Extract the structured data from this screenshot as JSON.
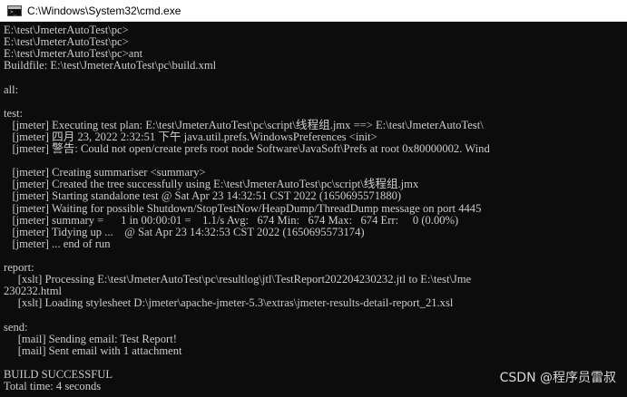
{
  "window": {
    "title": "C:\\Windows\\System32\\cmd.exe",
    "icon": "cmd-window-icon",
    "icon_glyph": ">_"
  },
  "console": {
    "text_color": "#cccccc",
    "background": "#0c0c0c",
    "lines": [
      "E:\\test\\JmeterAutoTest\\pc>",
      "E:\\test\\JmeterAutoTest\\pc>",
      "E:\\test\\JmeterAutoTest\\pc>ant",
      "Buildfile: E:\\test\\JmeterAutoTest\\pc\\build.xml",
      "",
      "all:",
      "",
      "test:",
      "   [jmeter] Executing test plan: E:\\test\\JmeterAutoTest\\pc\\script\\线程组.jmx ==> E:\\test\\JmeterAutoTest\\",
      "   [jmeter] 四月 23, 2022 2:32:51 下午 java.util.prefs.WindowsPreferences <init>",
      "   [jmeter] 警告: Could not open/create prefs root node Software\\JavaSoft\\Prefs at root 0x80000002. Wind",
      "",
      "   [jmeter] Creating summariser <summary>",
      "   [jmeter] Created the tree successfully using E:\\test\\JmeterAutoTest\\pc\\script\\线程组.jmx",
      "   [jmeter] Starting standalone test @ Sat Apr 23 14:32:51 CST 2022 (1650695571880)",
      "   [jmeter] Waiting for possible Shutdown/StopTestNow/HeapDump/ThreadDump message on port 4445",
      "   [jmeter] summary =      1 in 00:00:01 =    1.1/s Avg:   674 Min:   674 Max:   674 Err:     0 (0.00%)",
      "   [jmeter] Tidying up ...    @ Sat Apr 23 14:32:53 CST 2022 (1650695573174)",
      "   [jmeter] ... end of run",
      "",
      "report:",
      "     [xslt] Processing E:\\test\\JmeterAutoTest\\pc\\resultlog\\jtl\\TestReport202204230232.jtl to E:\\test\\Jme",
      "230232.html",
      "     [xslt] Loading stylesheet D:\\jmeter\\apache-jmeter-5.3\\extras\\jmeter-results-detail-report_21.xsl",
      "",
      "send:",
      "     [mail] Sending email: Test Report!",
      "     [mail] Sent email with 1 attachment",
      "",
      "BUILD SUCCESSFUL",
      "Total time: 4 seconds"
    ]
  },
  "watermark": {
    "text": "CSDN @程序员雷叔"
  }
}
